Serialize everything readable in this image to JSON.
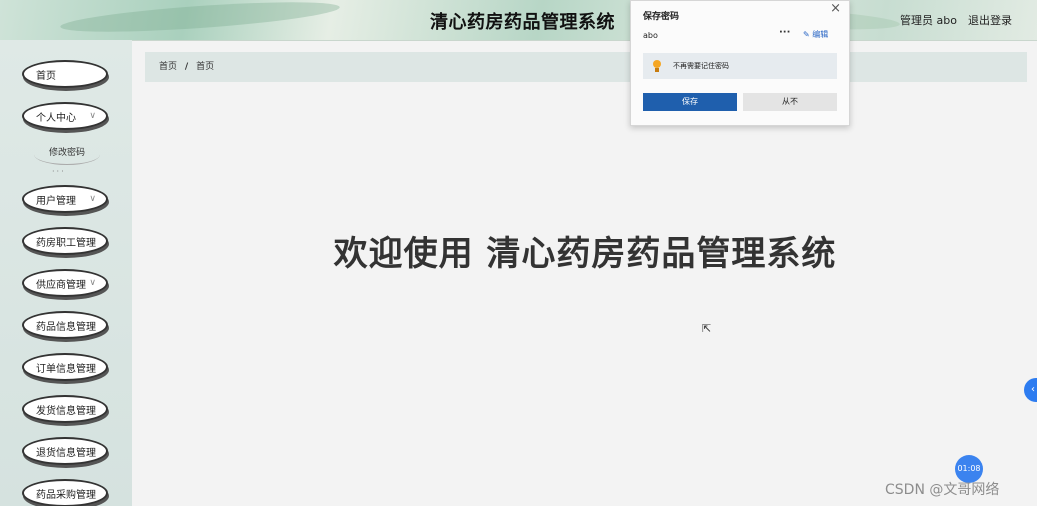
{
  "header": {
    "title": "清心药房药品管理系统",
    "user_label": "管理员 abo",
    "logout_label": "退出登录"
  },
  "sidebar": {
    "items": [
      {
        "label": "首页"
      },
      {
        "label": "个人中心",
        "has_chevron": true
      },
      {
        "label": "用户管理",
        "has_chevron": true
      },
      {
        "label": "药房职工管理"
      },
      {
        "label": "供应商管理",
        "has_chevron": true
      },
      {
        "label": "药品信息管理"
      },
      {
        "label": "订单信息管理"
      },
      {
        "label": "发货信息管理"
      },
      {
        "label": "退货信息管理"
      },
      {
        "label": "药品采购管理"
      }
    ],
    "submenu": {
      "label": "修改密码"
    }
  },
  "breadcrumb": {
    "home": "首页",
    "separator": "/",
    "current": "首页"
  },
  "main": {
    "welcome": "欢迎使用 清心药房药品管理系统"
  },
  "password_popup": {
    "title": "保存密码",
    "close_icon": "close-icon",
    "username": "abo",
    "more_label": "···",
    "edit_label": "✎ 编辑",
    "hint": "不再需要记住密码",
    "save_label": "保存",
    "never_label": "从不"
  },
  "overlay": {
    "timer": "01:08",
    "watermark": "CSDN @文哥网络",
    "side_toggle": "‹"
  },
  "colors": {
    "primary_button": "#1f5fad",
    "toggle_blue": "#2d7cf0",
    "breadcrumb_bg": "#dde6e4"
  }
}
